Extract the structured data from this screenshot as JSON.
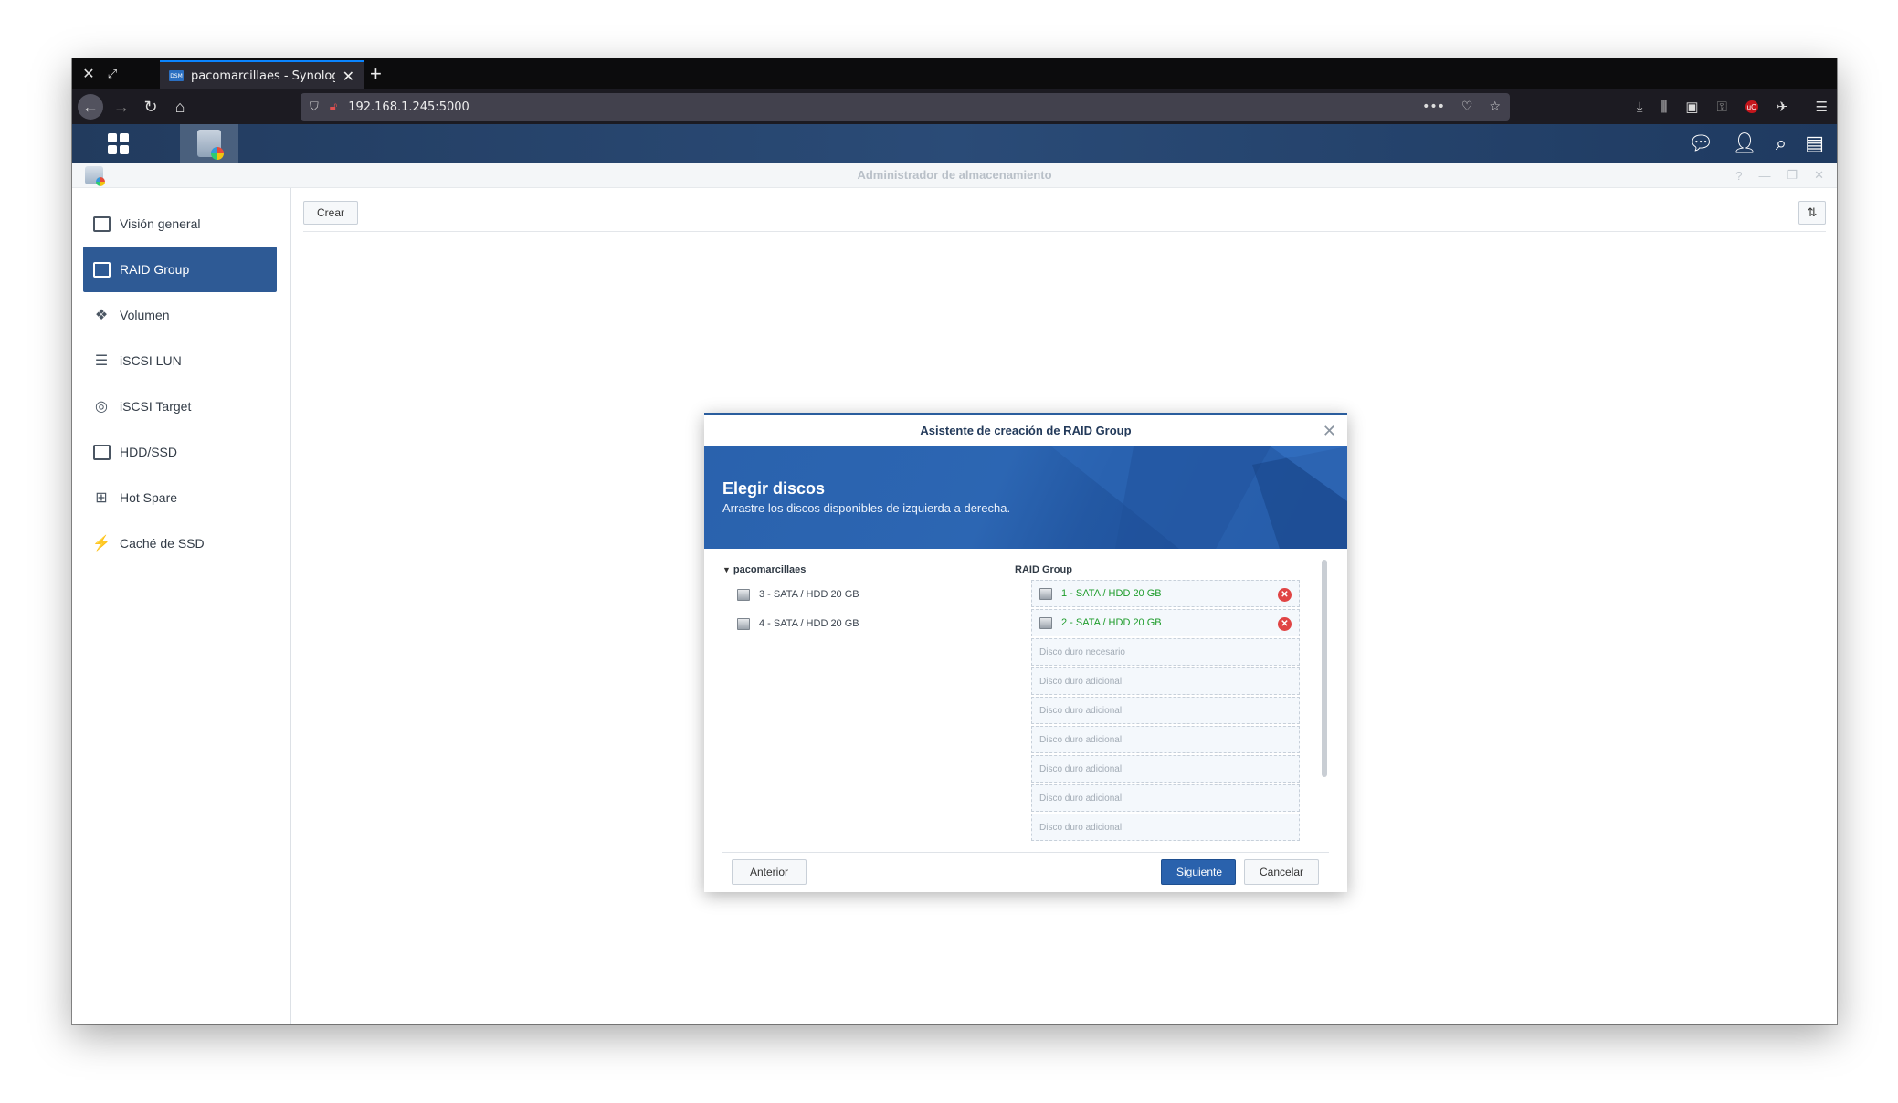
{
  "browser": {
    "tab_title": "pacomarcillaes - Synology Di",
    "tab_favicon": "DSM",
    "url": "192.168.1.245:5000"
  },
  "app": {
    "title": "Administrador de almacenamiento"
  },
  "sidebar": {
    "items": [
      {
        "label": "Visión general",
        "icon": "overview-icon",
        "active": false
      },
      {
        "label": "RAID Group",
        "icon": "raid-group-icon",
        "active": true
      },
      {
        "label": "Volumen",
        "icon": "volume-icon",
        "active": false
      },
      {
        "label": "iSCSI LUN",
        "icon": "iscsi-lun-icon",
        "active": false
      },
      {
        "label": "iSCSI Target",
        "icon": "iscsi-target-icon",
        "active": false
      },
      {
        "label": "HDD/SSD",
        "icon": "hdd-ssd-icon",
        "active": false
      },
      {
        "label": "Hot Spare",
        "icon": "hot-spare-icon",
        "active": false
      },
      {
        "label": "Caché de SSD",
        "icon": "ssd-cache-icon",
        "active": false
      }
    ]
  },
  "toolbar": {
    "create_label": "Crear"
  },
  "dialog": {
    "title": "Asistente de creación de RAID Group",
    "heading": "Elegir discos",
    "subheading": "Arrastre los discos disponibles de izquierda a derecha.",
    "left_pane": {
      "group": "pacomarcillaes",
      "disks": [
        "3 - SATA / HDD 20 GB",
        "4 - SATA / HDD 20 GB"
      ]
    },
    "right_pane": {
      "title": "RAID Group",
      "selected": [
        "1 - SATA / HDD 20 GB",
        "2 - SATA / HDD 20 GB"
      ],
      "placeholders": [
        "Disco duro necesario",
        "Disco duro adicional",
        "Disco duro adicional",
        "Disco duro adicional",
        "Disco duro adicional",
        "Disco duro adicional",
        "Disco duro adicional"
      ]
    },
    "buttons": {
      "prev": "Anterior",
      "next": "Siguiente",
      "cancel": "Cancelar"
    }
  },
  "colors": {
    "accent": "#2a62ad",
    "sidebar_active": "#2e5a95",
    "selected_disk_text": "#1e9c2b",
    "remove": "#e04444"
  }
}
